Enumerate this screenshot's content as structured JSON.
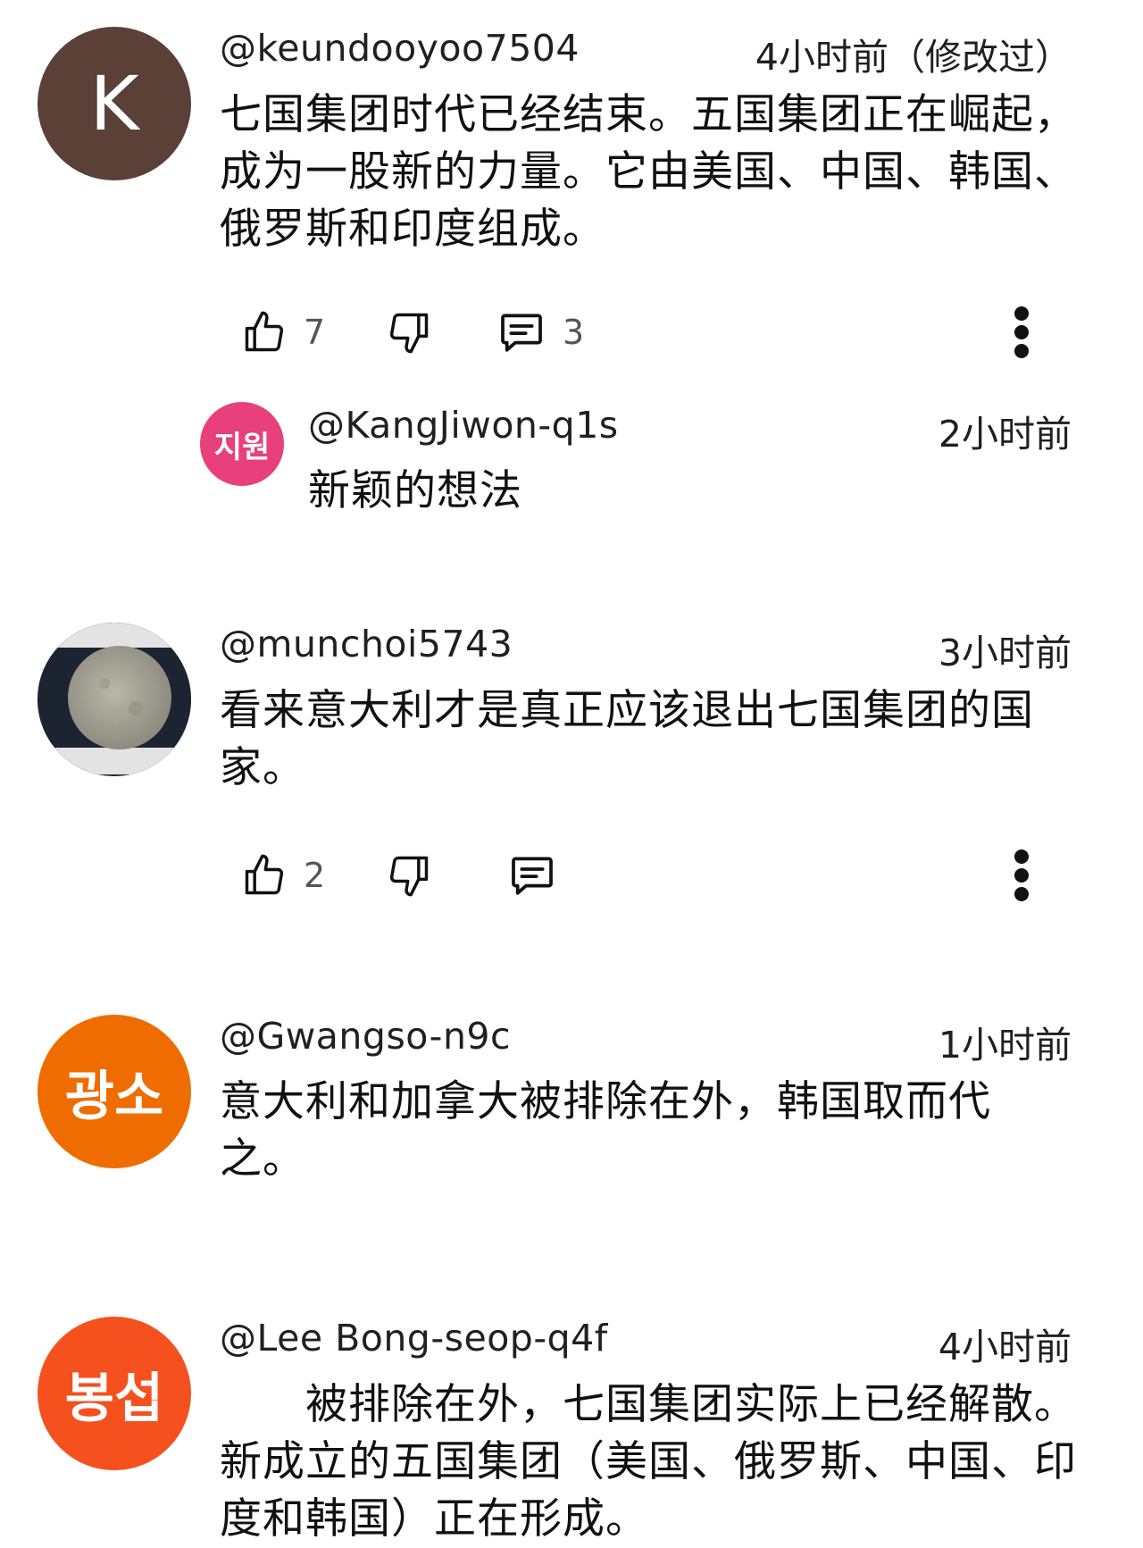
{
  "comments": [
    {
      "handle": "@keundooyoo7504",
      "time": "4小时前（修改过）",
      "avatar_text": "K",
      "avatar_color": "#5b4037",
      "text": "七国集团时代已经结束。五国集团正在崛起，成为一股新的力量。它由美国、中国、韩国、俄罗斯和印度组成。",
      "likes": "7",
      "replies": "3",
      "reply": {
        "handle": "@KangJiwon-q1s",
        "time": "2小时前",
        "avatar_text": "지원",
        "avatar_color": "#e8407b",
        "text": "新颖的想法"
      }
    },
    {
      "handle": "@munchoi5743",
      "time": "3小时前",
      "text": "看来意大利才是真正应该退出七国集团的国家。",
      "likes": "2"
    },
    {
      "handle": "@Gwangso-n9c",
      "time": "1小时前",
      "avatar_text": "광소",
      "avatar_color": "#ef6c00",
      "text": "意大利和加拿大被排除在外，韩国取而代之。"
    },
    {
      "handle": "@Lee Bong-seop-q4f",
      "time": "4小时前",
      "avatar_text": "봉섭",
      "avatar_color": "#f4511e",
      "text": "被排除在外，七国集团实际上已经解散。新成立的五国集团（美国、俄罗斯、中国、印度和韩国）正在形成。"
    }
  ]
}
